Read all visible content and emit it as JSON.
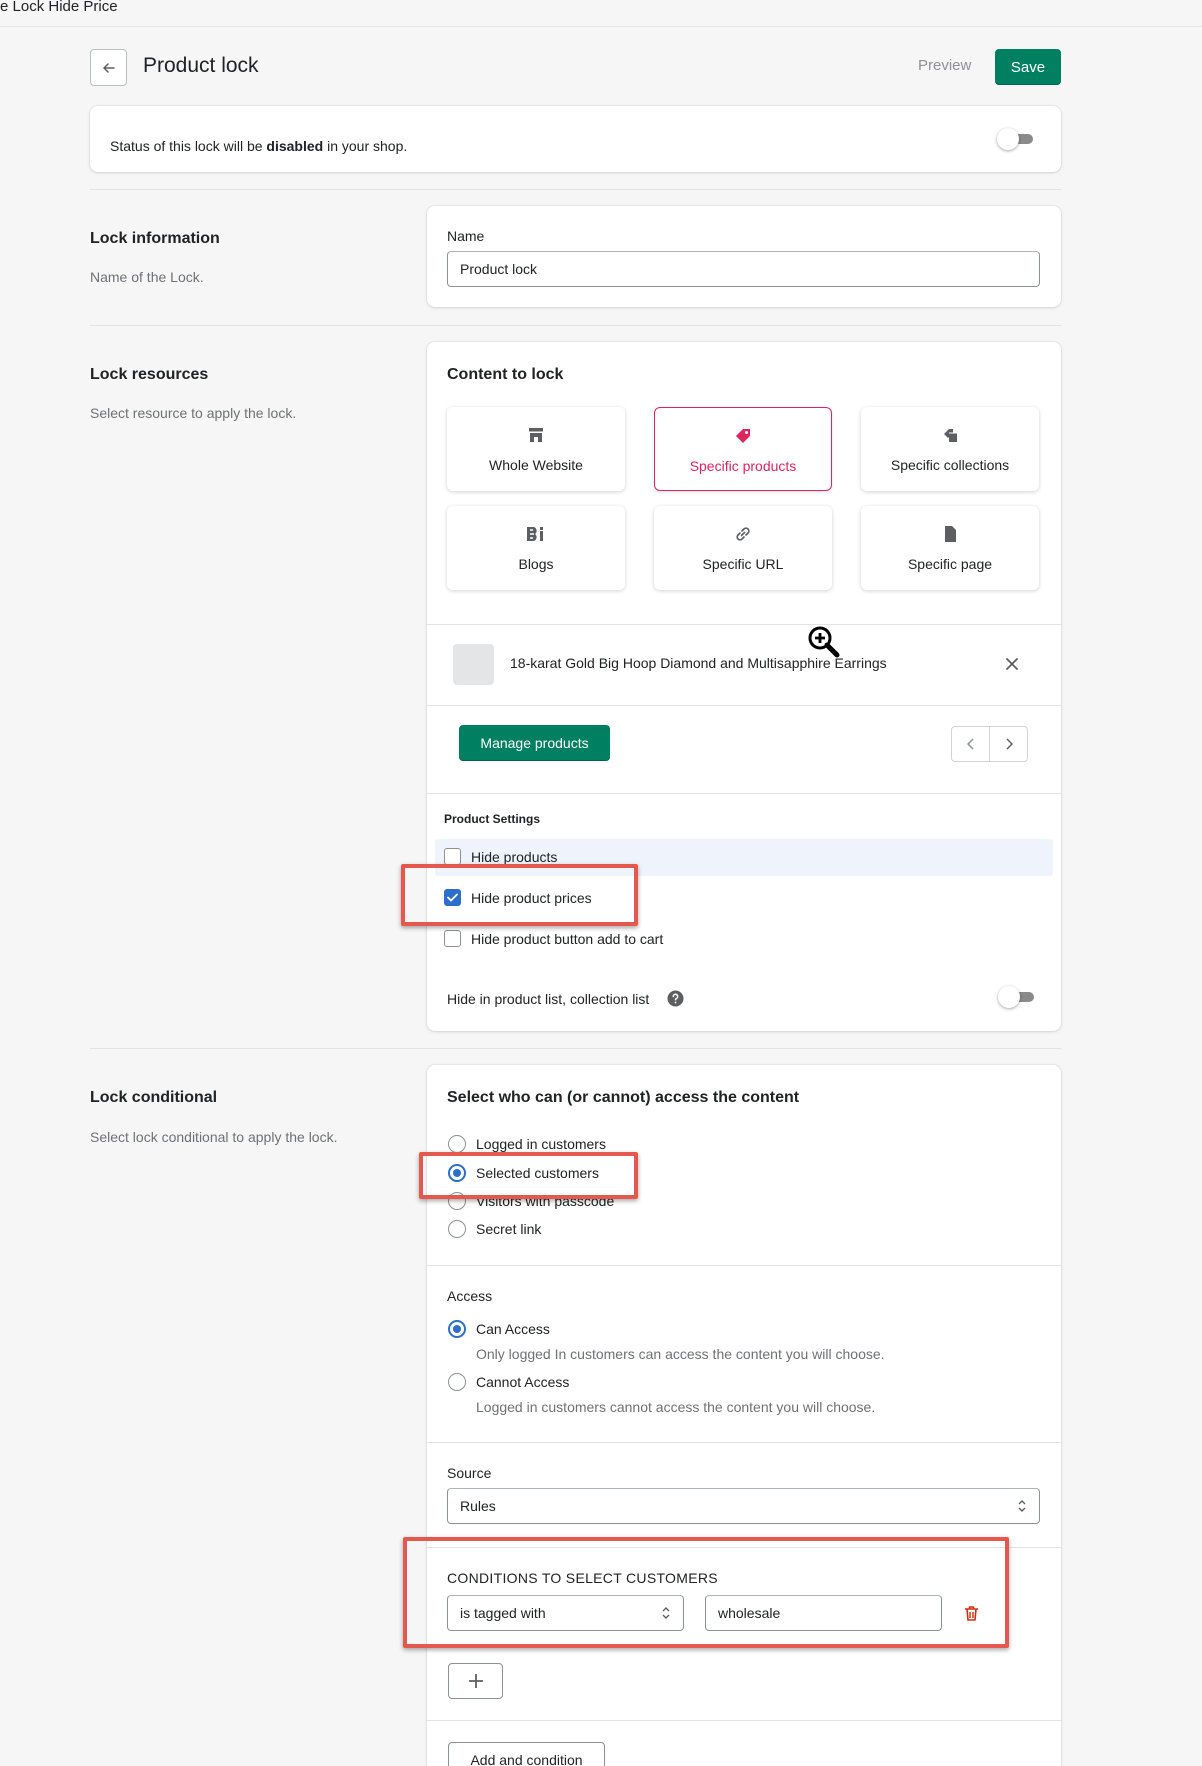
{
  "app": {
    "topbar_title": "e Lock Hide Price"
  },
  "header": {
    "title": "Product lock",
    "preview_label": "Preview",
    "save_label": "Save"
  },
  "status": {
    "text_before": "Status of this lock will be ",
    "text_bold": "disabled",
    "text_after": " in your shop.",
    "enabled": false
  },
  "lock_information": {
    "title": "Lock information",
    "description": "Name of the Lock.",
    "name_label": "Name",
    "name_value": "Product lock"
  },
  "lock_resources": {
    "title": "Lock resources",
    "description": "Select resource to apply the lock.",
    "content_heading": "Content to lock",
    "tiles": [
      {
        "label": "Whole Website",
        "icon": "store-icon",
        "active": false
      },
      {
        "label": "Specific products",
        "icon": "tag-icon",
        "active": true
      },
      {
        "label": "Specific collections",
        "icon": "collections-icon",
        "active": false
      },
      {
        "label": "Blogs",
        "icon": "blog-icon",
        "active": false
      },
      {
        "label": "Specific URL",
        "icon": "link-icon",
        "active": false
      },
      {
        "label": "Specific page",
        "icon": "page-icon",
        "active": false
      }
    ],
    "selected_product": "18-karat Gold Big Hoop Diamond and Multisapphire Earrings",
    "manage_label": "Manage products",
    "product_settings_heading": "Product Settings",
    "settings": [
      {
        "label": "Hide products",
        "checked": false
      },
      {
        "label": "Hide product prices",
        "checked": true
      },
      {
        "label": "Hide product button add to cart",
        "checked": false
      }
    ],
    "hide_in_list_label": "Hide in product list, collection list",
    "hide_in_list_enabled": false
  },
  "lock_conditional": {
    "title": "Lock conditional",
    "description": "Select lock conditional to apply the lock.",
    "who_heading": "Select who can (or cannot) access the content",
    "who_options": [
      {
        "label": "Logged in customers",
        "selected": false
      },
      {
        "label": "Selected customers",
        "selected": true
      },
      {
        "label": "Visitors with passcode",
        "selected": false
      },
      {
        "label": "Secret link",
        "selected": false
      }
    ],
    "access_heading": "Access",
    "access_options": [
      {
        "label": "Can Access",
        "help": "Only logged In customers can access the content you will choose.",
        "selected": true
      },
      {
        "label": "Cannot Access",
        "help": "Logged in customers cannot access the content you will choose.",
        "selected": false
      }
    ],
    "source_label": "Source",
    "source_value": "Rules",
    "conditions_heading": "CONDITIONS TO SELECT CUSTOMERS",
    "condition_operator": "is tagged with",
    "condition_value": "wholesale",
    "add_and_label": "Add and condition"
  },
  "colors": {
    "primary": "#008060",
    "accent": "#e0245e",
    "selection": "#2c6ecb",
    "annotation": "#e4584d"
  }
}
